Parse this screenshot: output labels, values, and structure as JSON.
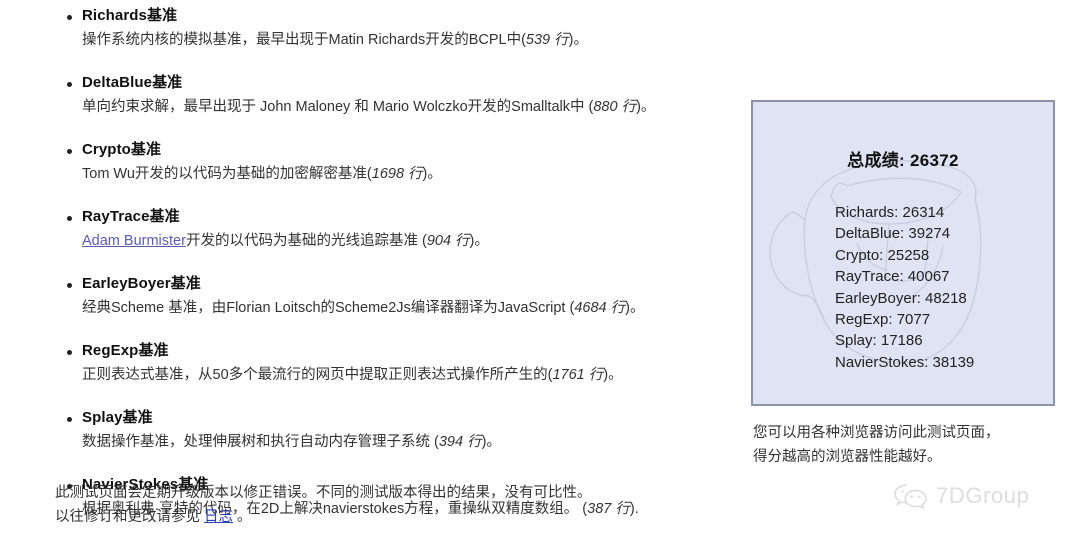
{
  "benchmarks": [
    {
      "title": "Richards基准",
      "desc_pre": "操作系统内核的模拟基准，最早出现于Matin Richards开发的BCPL中(",
      "lines": "539 行",
      "desc_post": ")。"
    },
    {
      "title": "DeltaBlue基准",
      "desc_pre": "单向约束求解，最早出现于 John Maloney 和 Mario Wolczko开发的Smalltalk中 (",
      "lines": "880 行",
      "desc_post": ")。"
    },
    {
      "title": "Crypto基准",
      "desc_pre": "Tom Wu开发的以代码为基础的加密解密基准(",
      "lines": "1698 行",
      "desc_post": ")。"
    },
    {
      "title": "RayTrace基准",
      "link_text": "Adam Burmister",
      "desc_pre": "开发的以代码为基础的光线追踪基准 (",
      "lines": "904 行",
      "desc_post": ")。"
    },
    {
      "title": "EarleyBoyer基准",
      "desc_pre": "经典Scheme 基准，由Florian Loitsch的Scheme2Js编译器翻译为JavaScript (",
      "lines": "4684 行",
      "desc_post": ")。"
    },
    {
      "title": "RegExp基准",
      "desc_pre": "正则表达式基准，从50多个最流行的网页中提取正则表达式操作所产生的(",
      "lines": "1761 行",
      "desc_post": ")。"
    },
    {
      "title": "Splay基准",
      "desc_pre": "数据操作基准，处理伸展树和执行自动内存管理子系统 (",
      "lines": "394 行",
      "desc_post": ")。"
    },
    {
      "title": "NavierStokes基准",
      "desc_pre": "根据奥利弗·亨特的代码，在2D上解决navierstokes方程，重操纵双精度数组。 (",
      "lines": "387 行",
      "desc_post": ")."
    }
  ],
  "footer": {
    "line1": "此测试页面会定期升级版本以修正错误。不同的测试版本得出的结果，没有可比性。",
    "line2_pre": "以往修订和更改请参见 ",
    "line2_link": "日志",
    "line2_post": " 。"
  },
  "score_box": {
    "title": "总成绩: 26372",
    "total_label": "总成绩",
    "total_value": "26372",
    "rows": [
      {
        "name": "Richards",
        "value": "26314",
        "text": "Richards: 26314"
      },
      {
        "name": "DeltaBlue",
        "value": "39274",
        "text": "DeltaBlue: 39274"
      },
      {
        "name": "Crypto",
        "value": "25258",
        "text": "Crypto: 25258"
      },
      {
        "name": "RayTrace",
        "value": "40067",
        "text": "RayTrace: 40067"
      },
      {
        "name": "EarleyBoyer",
        "value": "48218",
        "text": "EarleyBoyer: 48218"
      },
      {
        "name": "RegExp",
        "value": "7077",
        "text": "RegExp: 7077"
      },
      {
        "name": "Splay",
        "value": "17186",
        "text": "Splay: 17186"
      },
      {
        "name": "NavierStokes",
        "value": "38139",
        "text": "NavierStokes: 38139"
      }
    ],
    "background_color": "#dfe3f3",
    "border_color": "#8b93a8"
  },
  "right_note": {
    "line1": "您可以用各种浏览器访问此测试页面，",
    "line2": "得分越高的浏览器性能越好。"
  },
  "brand": {
    "name": "7DGroup",
    "icon": "wechat-icon",
    "color": "#dcdcdc"
  }
}
